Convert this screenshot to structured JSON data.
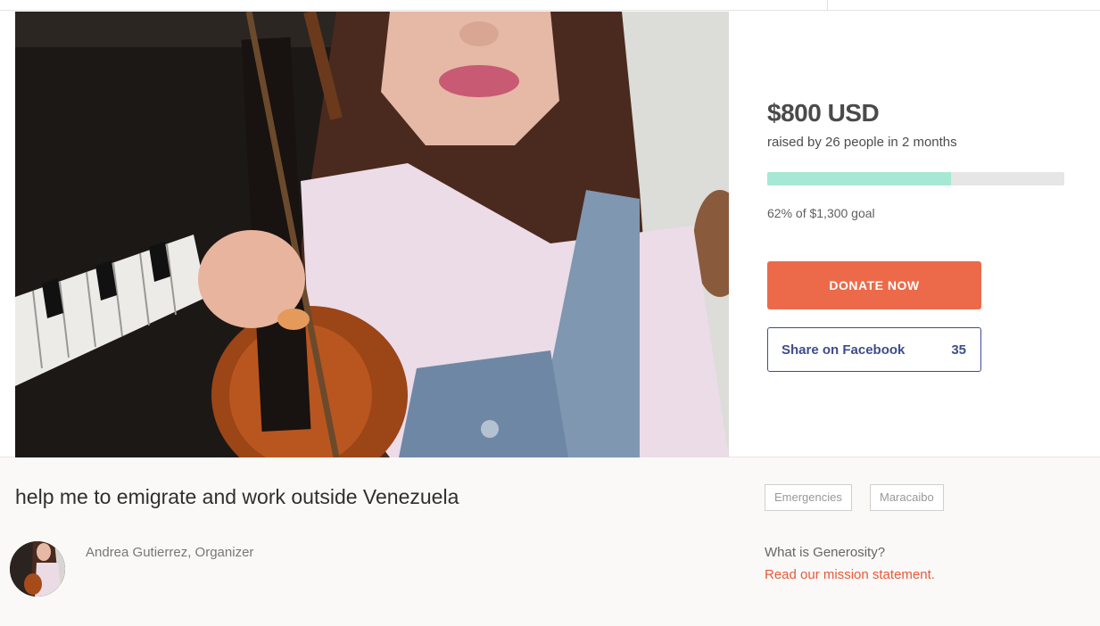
{
  "campaign": {
    "title": "help me to emigrate and work outside Venezuela",
    "amount": "$800 USD",
    "raised_text": "raised by 26 people in 2 months",
    "progress_percent": 62,
    "goal_text": "62% of $1,300 goal"
  },
  "actions": {
    "donate_label": "DONATE NOW",
    "share_label": "Share on Facebook",
    "share_count": "35"
  },
  "organizer": {
    "name_text": "Andrea Gutierrez, Organizer"
  },
  "tags": [
    "Emergencies",
    "Maracaibo"
  ],
  "generosity": {
    "question": "What is Generosity?",
    "link_text": "Read our mission statement."
  },
  "colors": {
    "donate": "#ec6a4a",
    "progress_fill": "#a6e8d4",
    "facebook": "#3e4d8c",
    "link": "#e8593a"
  }
}
